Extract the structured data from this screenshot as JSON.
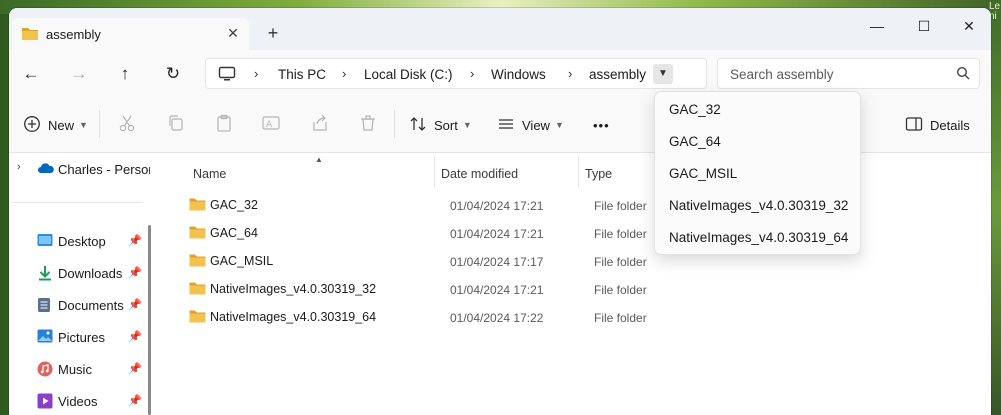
{
  "window": {
    "tab_title": "assembly",
    "new_tab": "+",
    "minimize": "—",
    "maximize": "☐",
    "close": "✕",
    "corner_text": "Le ni"
  },
  "nav": {
    "back": "←",
    "forward": "→",
    "up": "↑",
    "refresh": "↻"
  },
  "address": {
    "crumbs": [
      "This PC",
      "Local Disk (C:)",
      "Windows",
      "assembly"
    ],
    "separator": "›"
  },
  "search": {
    "placeholder": "Search assembly"
  },
  "toolbar": {
    "new_label": "New",
    "sort_label": "Sort",
    "view_label": "View",
    "more_label": "•••",
    "details_label": "Details"
  },
  "sidebar": {
    "onedrive_label": "Charles - Personal",
    "items": [
      {
        "label": "Desktop",
        "icon": "desktop-icon"
      },
      {
        "label": "Downloads",
        "icon": "download-icon"
      },
      {
        "label": "Documents",
        "icon": "documents-icon"
      },
      {
        "label": "Pictures",
        "icon": "pictures-icon"
      },
      {
        "label": "Music",
        "icon": "music-icon"
      },
      {
        "label": "Videos",
        "icon": "videos-icon"
      }
    ]
  },
  "columns": {
    "name": "Name",
    "date": "Date modified",
    "type": "Type"
  },
  "files": [
    {
      "name": "GAC_32",
      "date": "01/04/2024 17:21",
      "type": "File folder"
    },
    {
      "name": "GAC_64",
      "date": "01/04/2024 17:21",
      "type": "File folder"
    },
    {
      "name": "GAC_MSIL",
      "date": "01/04/2024 17:17",
      "type": "File folder"
    },
    {
      "name": "NativeImages_v4.0.30319_32",
      "date": "01/04/2024 17:21",
      "type": "File folder"
    },
    {
      "name": "NativeImages_v4.0.30319_64",
      "date": "01/04/2024 17:22",
      "type": "File folder"
    }
  ],
  "dropdown": {
    "items": [
      "GAC_32",
      "GAC_64",
      "GAC_MSIL",
      "NativeImages_v4.0.30319_32",
      "NativeImages_v4.0.30319_64"
    ]
  },
  "colors": {
    "folder": "#f2c14e",
    "folder_dark": "#dca332",
    "accent": "#0067c0"
  }
}
